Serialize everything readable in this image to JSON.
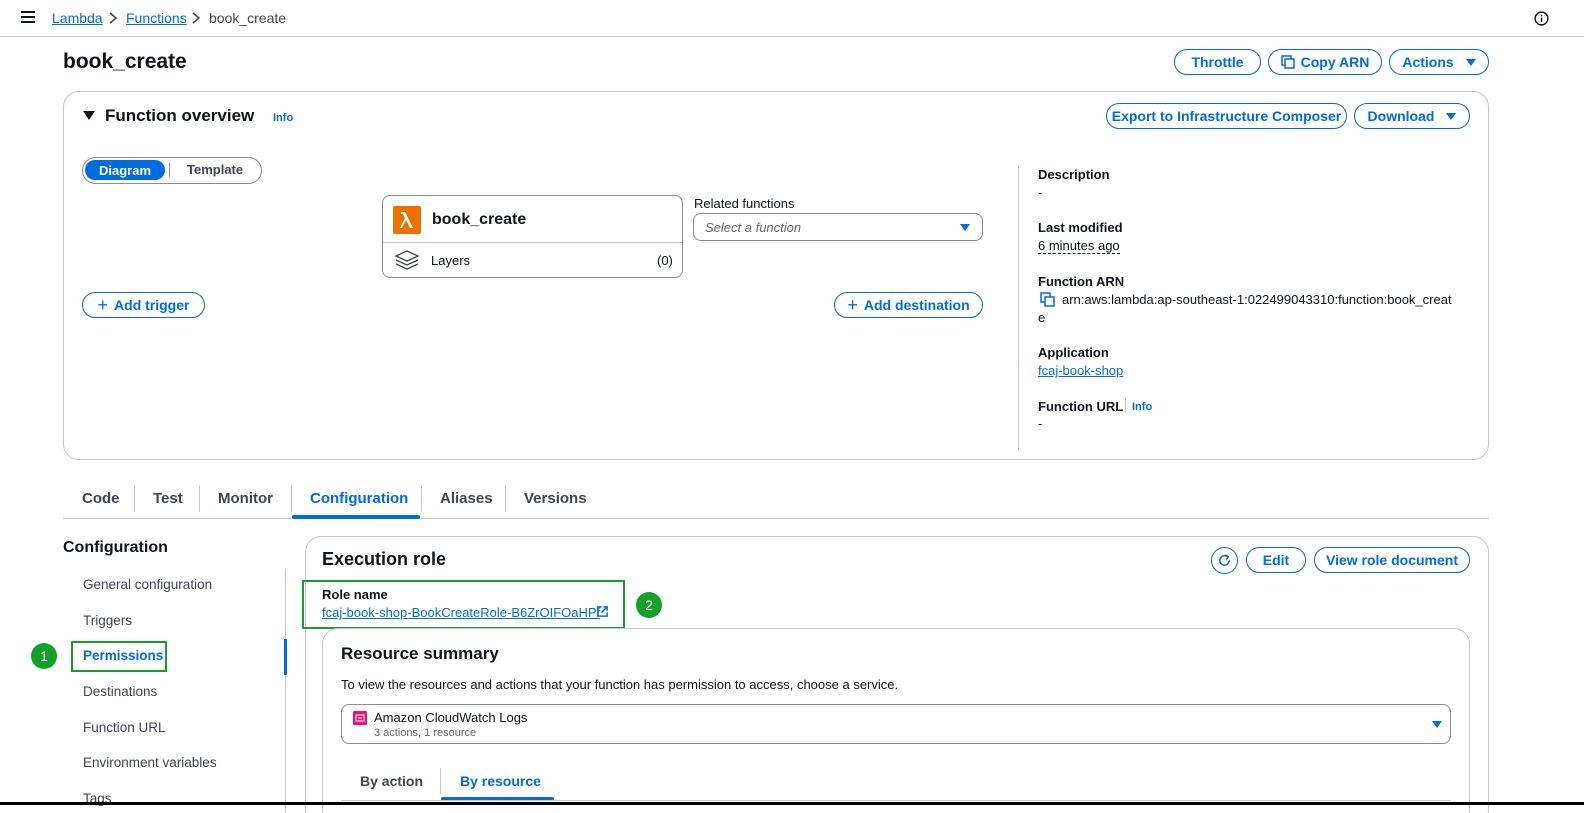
{
  "breadcrumb": {
    "root": "Lambda",
    "functions": "Functions",
    "current": "book_create"
  },
  "header": {
    "title": "book_create",
    "throttle": "Throttle",
    "copy_arn": "Copy ARN",
    "actions": "Actions"
  },
  "overview": {
    "title": "Function overview",
    "info": "Info",
    "export": "Export to Infrastructure Composer",
    "download": "Download",
    "toggle": {
      "diagram": "Diagram",
      "template": "Template"
    },
    "function_name": "book_create",
    "layers_label": "Layers",
    "layers_count": "(0)",
    "related_label": "Related functions",
    "related_placeholder": "Select a function",
    "add_trigger": "Add trigger",
    "add_destination": "Add destination",
    "details": {
      "description_label": "Description",
      "description_value": "-",
      "modified_label": "Last modified",
      "modified_value": "6 minutes ago",
      "arn_label": "Function ARN",
      "arn_line1": "arn:aws:lambda:ap-southeast-1:022499043310:function:book_creat",
      "arn_line2": "e",
      "application_label": "Application",
      "application_value": "fcaj-book-shop",
      "url_label": "Function URL",
      "url_info": "Info",
      "url_value": "-"
    }
  },
  "tabs": [
    "Code",
    "Test",
    "Monitor",
    "Configuration",
    "Aliases",
    "Versions"
  ],
  "config_nav": {
    "title": "Configuration",
    "items": [
      "General configuration",
      "Triggers",
      "Permissions",
      "Destinations",
      "Function URL",
      "Environment variables",
      "Tags"
    ]
  },
  "execution_role": {
    "title": "Execution role",
    "edit": "Edit",
    "view_doc": "View role document",
    "role_label": "Role name",
    "role_value": "fcaj-book-shop-BookCreateRole-B6ZrOIFOaHPf"
  },
  "resource_summary": {
    "title": "Resource summary",
    "desc": "To view the resources and actions that your function has permission to access, choose a service.",
    "service": "Amazon CloudWatch Logs",
    "service_sub": "3 actions, 1 resource",
    "tab_action": "By action",
    "tab_resource": "By resource"
  },
  "annotations": {
    "one": "1",
    "two": "2"
  },
  "colors": {
    "link": "#006ce0",
    "annotation": "#15a02a",
    "lambda": "#ed7100",
    "cloudwatch": "#e7157b"
  }
}
